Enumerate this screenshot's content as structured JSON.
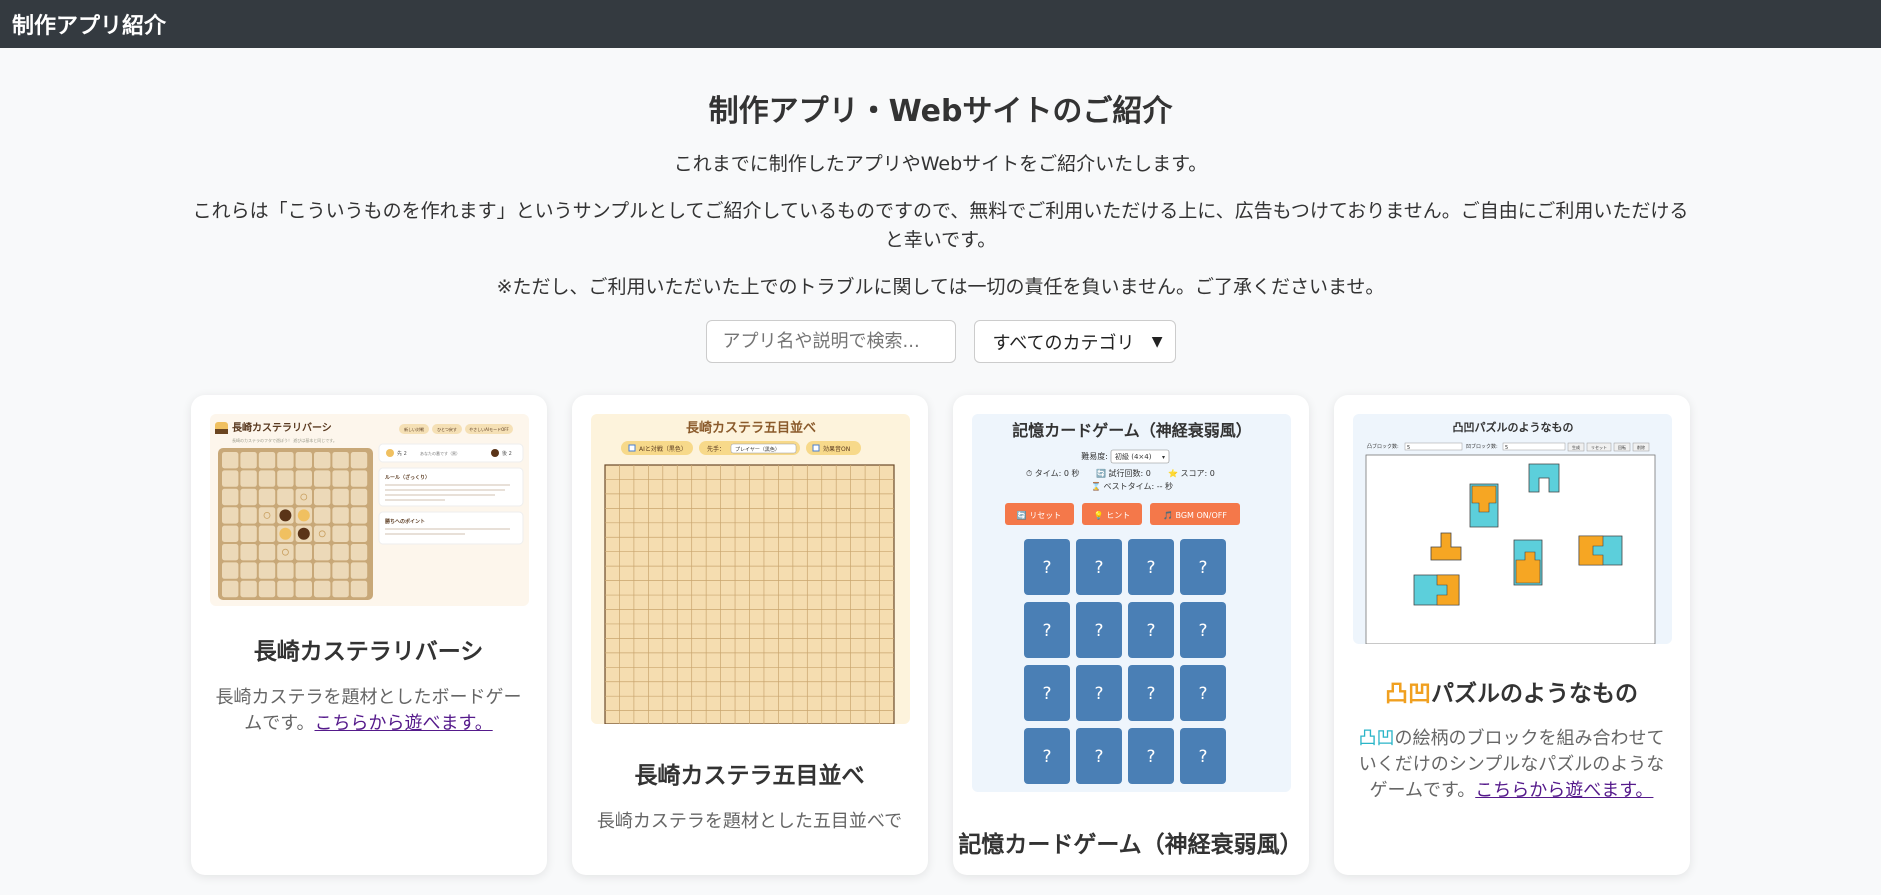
{
  "header": {
    "title": "制作アプリ紹介"
  },
  "intro": {
    "heading": "制作アプリ・Webサイトのご紹介",
    "p1": "これまでに制作したアプリやWebサイトをご紹介いたします。",
    "p2": "これらは「こういうものを作れます」というサンプルとしてご紹介しているものですので、無料でご利用いただける上に、広告もつけておりません。ご自由にご利用いただけると幸いです。",
    "p3": "※ただし、ご利用いただいた上でのトラブルに関しては一切の責任を負いません。ご了承くださいませ。"
  },
  "search": {
    "placeholder": "アプリ名や説明で検索..."
  },
  "category": {
    "selected": "すべてのカテゴリ"
  },
  "cards": [
    {
      "title": "長崎カステラリバーシ",
      "desc": "長崎カステラを題材としたボードゲームです。",
      "link": "こちらから遊べます。",
      "thumb": {
        "title": "長崎カステラリバーシ",
        "subtitle": "長崎のカステラのフタで遊ぼう！ 遊びは基本と同じです。",
        "buttons": [
          "新しい対戦",
          "ひとつ戻す",
          "やさしいAIモードOFF"
        ],
        "player1": "先 2",
        "status": "あなたの番です（黒）",
        "player2": "後 2",
        "rule_title": "ルール（ざっくり）",
        "tips_title": "勝ちへのポイント"
      }
    },
    {
      "title": "長崎カステラ五目並べ",
      "desc": "長崎カステラを題材とした五目並べで",
      "thumb": {
        "title": "長崎カステラ五目並べ",
        "opt1": "AIと対戦（黒色）",
        "opt2_label": "先手：",
        "opt2_value": "プレイヤー（黒色）",
        "opt3": "効果音ON"
      }
    },
    {
      "title": "記憶カードゲーム（神経衰弱風）",
      "thumb": {
        "title": "記憶カードゲーム（神経衰弱風）",
        "difficulty_label": "難易度:",
        "difficulty_value": "初級 (4×4)",
        "time": "⏱ タイム: 0 秒",
        "tries": "🔄 試行回数: 0",
        "score": "⭐ スコア: 0",
        "best": "⌛ ベストタイム: -- 秒",
        "reset": "🔄 リセット",
        "hint": "💡 ヒント",
        "bgm": "🎵 BGM ON/OFF",
        "card_face": "?"
      }
    },
    {
      "title_icons": "凸凹",
      "title": "パズルのようなもの",
      "desc_icons": "凸凹",
      "desc": "の絵柄のブロックを組み合わせていくだけのシンプルなパズルのようなゲームです。",
      "link": "こちらから遊べます。",
      "thumb": {
        "title": "凸凹パズルのようなもの",
        "label1": "凸ブロック数:",
        "value1": "5",
        "label2": "凹ブロック数:",
        "value2": "5",
        "btn1": "生成",
        "btn2": "リセット",
        "btn3": "回転",
        "btn4": "削除"
      }
    }
  ],
  "colors": {
    "header_bg": "#343a40",
    "memory_card": "#4a7fb5",
    "memory_button": "#f4784a",
    "castella_board": "#f5ddb0"
  }
}
